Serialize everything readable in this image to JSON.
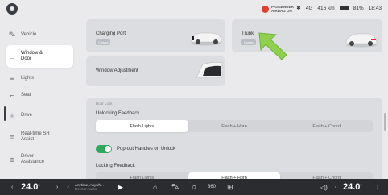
{
  "status": {
    "airbag_line1": "PASSENGER",
    "airbag_line2": "AIRBAG ON",
    "bluetooth_icon": "bluetooth-icon",
    "signal_label": "4G",
    "range": "416 km",
    "battery": "81%",
    "time": "18:43"
  },
  "sidebar": {
    "items": [
      {
        "label": "Vehicle",
        "icon": "car-icon"
      },
      {
        "label": "Window & Door",
        "icon": "door-icon"
      },
      {
        "label": "Lights",
        "icon": "lights-icon"
      },
      {
        "label": "Seat",
        "icon": "seat-icon"
      },
      {
        "label": "Drive",
        "icon": "steering-icon"
      },
      {
        "label": "Real-time SR Assist",
        "icon": "sr-assist-icon"
      },
      {
        "label": "Driver Assistance",
        "icon": "driver-assist-icon"
      }
    ]
  },
  "cards": {
    "charging_port": {
      "title": "Charging Port",
      "status": "Closed"
    },
    "trunk": {
      "title": "Trunk",
      "status": "Closed"
    },
    "window": {
      "title": "Window Adjustment"
    }
  },
  "door_lock": {
    "section_label": "Door Lock",
    "unlocking_title": "Unlocking Feedback",
    "unlocking_options": [
      "Flash Lights",
      "Flash + Horn",
      "Flash + Chord"
    ],
    "unlocking_selected": 0,
    "popout_label": "Pop-out Handles on Unlock",
    "popout_on": true,
    "locking_title": "Locking Feedback",
    "locking_options": [
      "Flash Lights",
      "Flash + Horn",
      "Flash + Chord"
    ],
    "locking_selected": 1
  },
  "bottom": {
    "temp_left": "24.0",
    "temp_right": "24.0",
    "degree": "°",
    "media_title": "Anytime, Anywh...",
    "media_sub": "Deezer Audio"
  },
  "colors": {
    "accent": "#2ea95c",
    "bottom_bar": "#2b2c30"
  }
}
